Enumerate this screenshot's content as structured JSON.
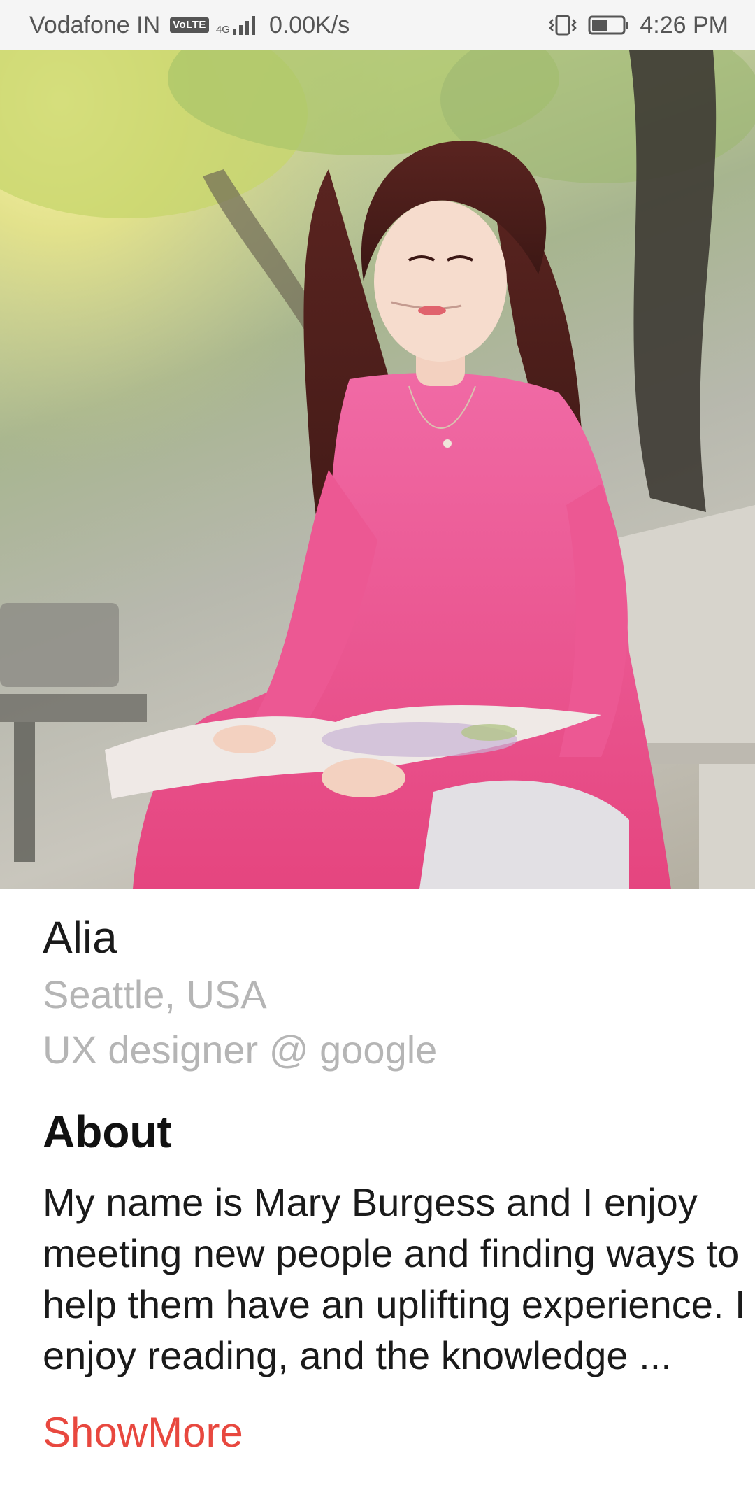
{
  "status_bar": {
    "carrier": "Vodafone IN",
    "volte": "VoLTE",
    "network_type": "4G",
    "data_speed": "0.00K/s",
    "time": "4:26 PM",
    "icons": [
      "volte-icon",
      "signal-icon",
      "vibrate-icon",
      "battery-icon"
    ]
  },
  "hero": {
    "image": "profile-photo-icon"
  },
  "profile": {
    "name": "Alia",
    "location": "Seattle, USA",
    "role": "UX designer @ google"
  },
  "about": {
    "heading": "About",
    "text": "My name is Mary Burgess and I enjoy meeting new people and finding ways to help them have an uplifting experience. I enjoy reading, and the knowledge ...",
    "show_more_label": "ShowMore"
  },
  "colors": {
    "accent": "#e8483f",
    "secondary_text": "#b5b5b5",
    "status_bar_bg": "#f5f5f5"
  }
}
